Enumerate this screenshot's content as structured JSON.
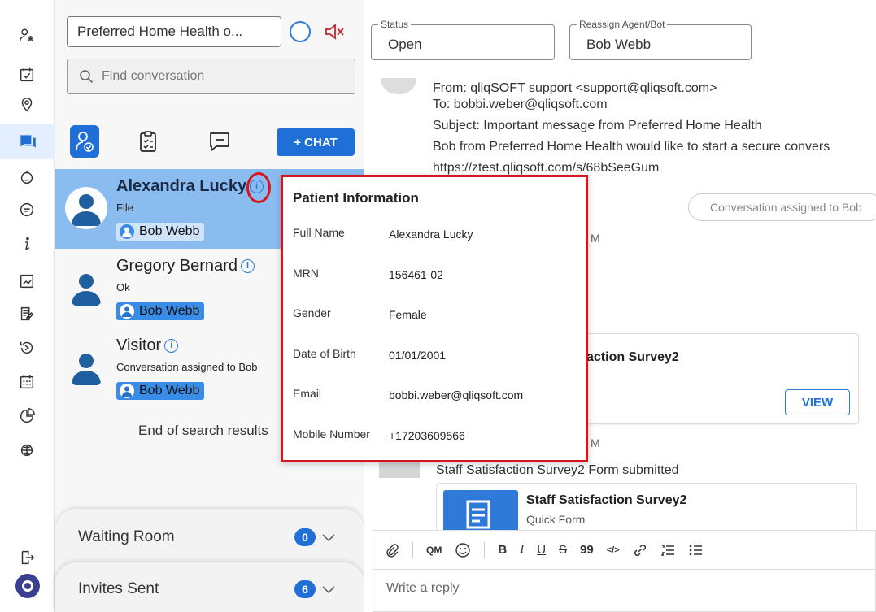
{
  "rail": {
    "icons": [
      "agent-settings-icon",
      "calendar-check-icon",
      "location-icon",
      "chat-icon",
      "bot-icon",
      "message-icon",
      "info-icon",
      "report-icon",
      "form-edit-icon",
      "history-icon",
      "calendar-icon",
      "pie-chart-icon",
      "network-icon"
    ],
    "logout_icon": "logout-icon",
    "logo": "qliqsoft-logo"
  },
  "panel": {
    "org_select": "Preferred Home Health o...",
    "search_placeholder": "Find conversation",
    "chat_button": "+ CHAT",
    "conversations": [
      {
        "name": "Alexandra Lucky",
        "preview": "File",
        "agent": "Bob Webb",
        "selected": true
      },
      {
        "name": "Gregory Bernard",
        "preview": "Ok",
        "agent": "Bob Webb",
        "selected": false
      },
      {
        "name": "Visitor",
        "preview": "Conversation assigned to Bob",
        "agent": "Bob Webb",
        "selected": false
      }
    ],
    "end_results": "End of search results",
    "waiting_room": {
      "label": "Waiting Room",
      "count": "0"
    },
    "invites_sent": {
      "label": "Invites Sent",
      "count": "6"
    }
  },
  "header": {
    "status_legend": "Status",
    "status_value": "Open",
    "reassign_legend": "Reassign Agent/Bot",
    "reassign_value": "Bob Webb"
  },
  "messages": {
    "email_lines": [
      "From: qliqSOFT support <support@qliqsoft.com>",
      "To: bobbi.weber@qliqsoft.com",
      "Subject: Important message from Preferred Home Health",
      "Bob from Preferred Home Health would like to start a secure convers",
      "https://ztest.qliqsoft.com/s/68bSeeGum"
    ],
    "system_pill": "Conversation assigned to Bob",
    "survey_title": "action Survey2",
    "view_button": "VIEW",
    "submitted_text": "Staff Satisfaction Survey2 Form submitted",
    "form_title": "Staff Satisfaction Survey2",
    "form_subtitle": "Quick Form",
    "time_fragment_1": "M",
    "time_fragment_2": "M"
  },
  "composer": {
    "toolbar": [
      "QM",
      "B",
      "I",
      "U",
      "S",
      "99",
      "</>"
    ],
    "placeholder": "Write a reply"
  },
  "popover": {
    "title": "Patient Information",
    "rows": [
      {
        "label": "Full Name",
        "value": "Alexandra Lucky"
      },
      {
        "label": "MRN",
        "value": "156461-02"
      },
      {
        "label": "Gender",
        "value": "Female"
      },
      {
        "label": "Date of Birth",
        "value": "01/01/2001"
      },
      {
        "label": "Email",
        "value": "bobbi.weber@qliqsoft.com"
      },
      {
        "label": "Mobile Number",
        "value": "+17203609566"
      }
    ]
  },
  "colors": {
    "accent": "#1f6fd6",
    "selected_row": "#8bbcf0",
    "callout": "#d8141c"
  }
}
